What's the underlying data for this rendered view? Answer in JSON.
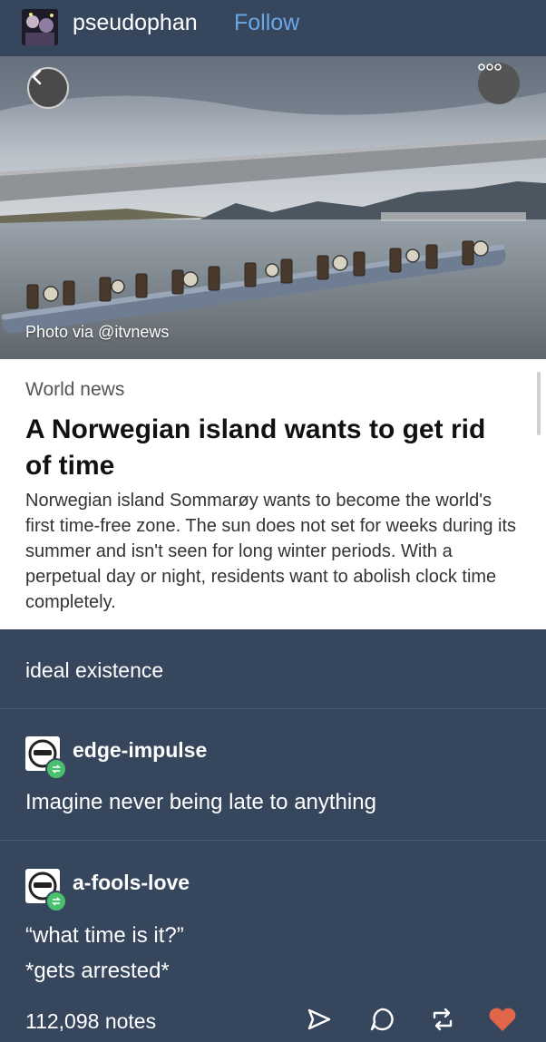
{
  "header": {
    "username": "pseudophan",
    "follow_label": "Follow"
  },
  "photo": {
    "credit": "Photo via @itvnews"
  },
  "article": {
    "section": "World news",
    "headline": "A Norwegian island wants to get rid of time",
    "body": "Norwegian island Sommarøy wants to become the world's first time-free zone. The sun does not set for weeks during its summer and isn't seen for long winter periods. With a perpetual day or night, residents want to abolish clock time completely."
  },
  "caption": "ideal existence",
  "reblogs": [
    {
      "username": "edge-impulse",
      "lines": [
        "Imagine never being late to anything"
      ]
    },
    {
      "username": "a-fools-love",
      "lines": [
        "“what time is it?”",
        "*gets arrested*"
      ]
    }
  ],
  "footer": {
    "notes": "112,098 notes"
  },
  "colors": {
    "background": "#36465d",
    "follow": "#6aa7e8",
    "like": "#e0664a",
    "reblog_badge": "#49c06d"
  },
  "icons": [
    "back-icon",
    "more-icon",
    "share-icon",
    "reply-icon",
    "reblog-icon",
    "like-icon"
  ]
}
